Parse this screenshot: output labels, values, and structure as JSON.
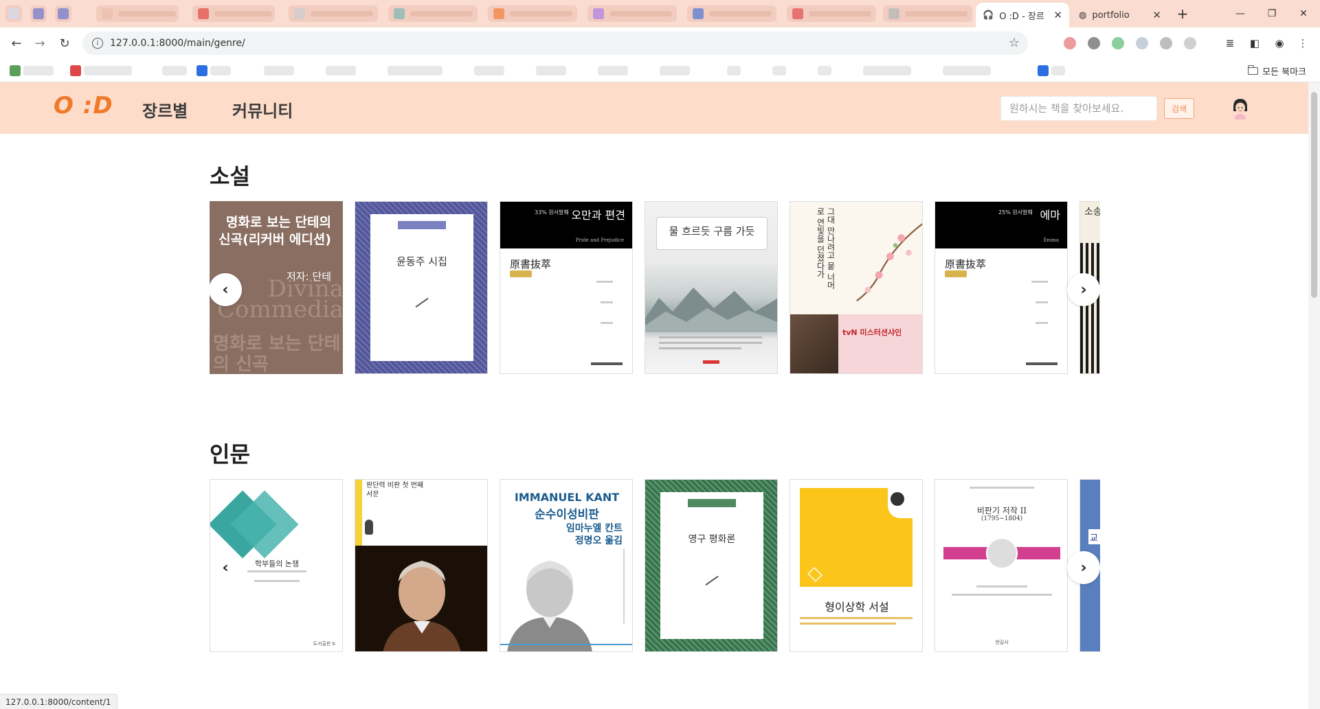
{
  "browser": {
    "active_tab_title": "O :D - 장르",
    "second_tab_title": "portfolio",
    "close_glyph": "✕",
    "new_tab_glyph": "+",
    "url": "127.0.0.1:8000/main/genre/",
    "all_bookmarks_label": "모든 북마크",
    "status_url": "127.0.0.1:8000/content/1"
  },
  "header": {
    "logo": "O :D",
    "nav": [
      "장르별",
      "커뮤니티"
    ],
    "search_placeholder": "원하시는 책을 찾아보세요.",
    "search_button": "검색"
  },
  "sections": [
    {
      "title": "소설",
      "books": [
        {
          "cover_title": "명화로 보는 단테의 신곡(리커버 에디션)",
          "cover_author": "저자: 단테",
          "cover_bg": "Divina Commedia",
          "cover_bottom": "명화로 보는 단테의 신곡"
        },
        {
          "cover_title": "윤동주 시집"
        },
        {
          "cover_title": "오만과 편견",
          "cover_series": "原書抜萃",
          "cover_badge": "33% 원서발췌",
          "cover_en": "Pride and Prejudice"
        },
        {
          "cover_title": "물 흐르듯 구름 가듯"
        },
        {
          "cover_title": "그대 만나려고 뭍 너머로 연빛을 던졌다가",
          "cover_brand": "tvN 미스터션샤인"
        },
        {
          "cover_title": "에마",
          "cover_series": "原書抜萃",
          "cover_badge": "25% 원서발췌",
          "cover_en": "Emma"
        },
        {
          "cover_title": "소송"
        }
      ]
    },
    {
      "title": "인문",
      "books": [
        {
          "cover_title": "학부들의 논쟁",
          "cover_publisher": "도서출판 b"
        },
        {
          "cover_title": "판단력 비판 첫 번째 서문"
        },
        {
          "cover_title": "순수이성비판",
          "cover_author_en": "IMMANUEL KANT",
          "cover_author": "임마누엘 칸트",
          "cover_translator": "정명오 옮김"
        },
        {
          "cover_title": "영구 평화론"
        },
        {
          "cover_title": "형이상학 서설"
        },
        {
          "cover_title": "비판기 저작 II",
          "cover_years": "(1795~1804)",
          "cover_publisher": "한길사"
        },
        {
          "cover_title": "교"
        }
      ]
    }
  ]
}
